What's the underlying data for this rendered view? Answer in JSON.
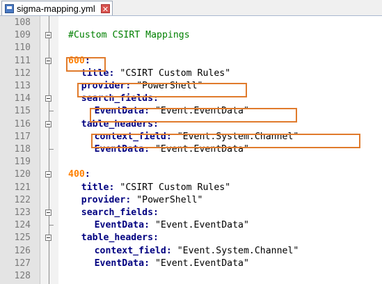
{
  "tab": {
    "filename": "sigma-mapping.yml",
    "close_glyph": "✕"
  },
  "colors": {
    "highlight": "#e07b2c",
    "comment": "#008000",
    "number": "#ff8000",
    "key": "#000080"
  },
  "lines": [
    {
      "num": "108",
      "fold": "none",
      "indent": 0,
      "segments": []
    },
    {
      "num": "109",
      "fold": "open",
      "indent": 0,
      "segments": [
        {
          "t": "#Custom CSIRT Mappings",
          "c": "comment"
        }
      ]
    },
    {
      "num": "110",
      "fold": "none",
      "indent": 0,
      "segments": []
    },
    {
      "num": "111",
      "fold": "open",
      "indent": 0,
      "segments": [
        {
          "t": "600",
          "c": "num"
        },
        {
          "t": ":",
          "c": "colon"
        }
      ]
    },
    {
      "num": "112",
      "fold": "none",
      "indent": 2,
      "segments": [
        {
          "t": "title",
          "c": "key"
        },
        {
          "t": ": ",
          "c": "colon"
        },
        {
          "t": "\"CSIRT Custom Rules\"",
          "c": "str"
        }
      ]
    },
    {
      "num": "113",
      "fold": "none",
      "indent": 2,
      "segments": [
        {
          "t": "provider",
          "c": "key"
        },
        {
          "t": ": ",
          "c": "colon"
        },
        {
          "t": "\"PowerShell\"",
          "c": "str"
        }
      ]
    },
    {
      "num": "114",
      "fold": "open",
      "indent": 2,
      "segments": [
        {
          "t": "search_fields",
          "c": "key"
        },
        {
          "t": ":",
          "c": "colon"
        }
      ]
    },
    {
      "num": "115",
      "fold": "end",
      "indent": 4,
      "segments": [
        {
          "t": "EventData",
          "c": "key"
        },
        {
          "t": ": ",
          "c": "colon"
        },
        {
          "t": "\"Event.EventData\"",
          "c": "str"
        }
      ]
    },
    {
      "num": "116",
      "fold": "open",
      "indent": 2,
      "segments": [
        {
          "t": "table_headers",
          "c": "key"
        },
        {
          "t": ":",
          "c": "colon"
        }
      ]
    },
    {
      "num": "117",
      "fold": "none",
      "indent": 4,
      "segments": [
        {
          "t": "context_field",
          "c": "key"
        },
        {
          "t": ": ",
          "c": "colon"
        },
        {
          "t": "\"Event.System.Channel\"",
          "c": "str"
        }
      ]
    },
    {
      "num": "118",
      "fold": "end",
      "indent": 4,
      "segments": [
        {
          "t": "EventData",
          "c": "key"
        },
        {
          "t": ": ",
          "c": "colon"
        },
        {
          "t": "\"Event.EventData\"",
          "c": "str"
        }
      ]
    },
    {
      "num": "119",
      "fold": "none",
      "indent": 0,
      "segments": []
    },
    {
      "num": "120",
      "fold": "open",
      "indent": 0,
      "segments": [
        {
          "t": "400",
          "c": "num"
        },
        {
          "t": ":",
          "c": "colon"
        }
      ]
    },
    {
      "num": "121",
      "fold": "none",
      "indent": 2,
      "segments": [
        {
          "t": "title",
          "c": "key"
        },
        {
          "t": ": ",
          "c": "colon"
        },
        {
          "t": "\"CSIRT Custom Rules\"",
          "c": "str"
        }
      ]
    },
    {
      "num": "122",
      "fold": "none",
      "indent": 2,
      "segments": [
        {
          "t": "provider",
          "c": "key"
        },
        {
          "t": ": ",
          "c": "colon"
        },
        {
          "t": "\"PowerShell\"",
          "c": "str"
        }
      ]
    },
    {
      "num": "123",
      "fold": "open",
      "indent": 2,
      "segments": [
        {
          "t": "search_fields",
          "c": "key"
        },
        {
          "t": ":",
          "c": "colon"
        }
      ]
    },
    {
      "num": "124",
      "fold": "end",
      "indent": 4,
      "segments": [
        {
          "t": "EventData",
          "c": "key"
        },
        {
          "t": ": ",
          "c": "colon"
        },
        {
          "t": "\"Event.EventData\"",
          "c": "str"
        }
      ]
    },
    {
      "num": "125",
      "fold": "open",
      "indent": 2,
      "segments": [
        {
          "t": "table_headers",
          "c": "key"
        },
        {
          "t": ":",
          "c": "colon"
        }
      ]
    },
    {
      "num": "126",
      "fold": "none",
      "indent": 4,
      "segments": [
        {
          "t": "context_field",
          "c": "key"
        },
        {
          "t": ": ",
          "c": "colon"
        },
        {
          "t": "\"Event.System.Channel\"",
          "c": "str"
        }
      ]
    },
    {
      "num": "127",
      "fold": "none",
      "indent": 4,
      "segments": [
        {
          "t": "EventData",
          "c": "key"
        },
        {
          "t": ": ",
          "c": "colon"
        },
        {
          "t": "\"Event.EventData\"",
          "c": "str"
        }
      ]
    },
    {
      "num": "128",
      "fold": "none",
      "indent": 0,
      "segments": []
    }
  ]
}
